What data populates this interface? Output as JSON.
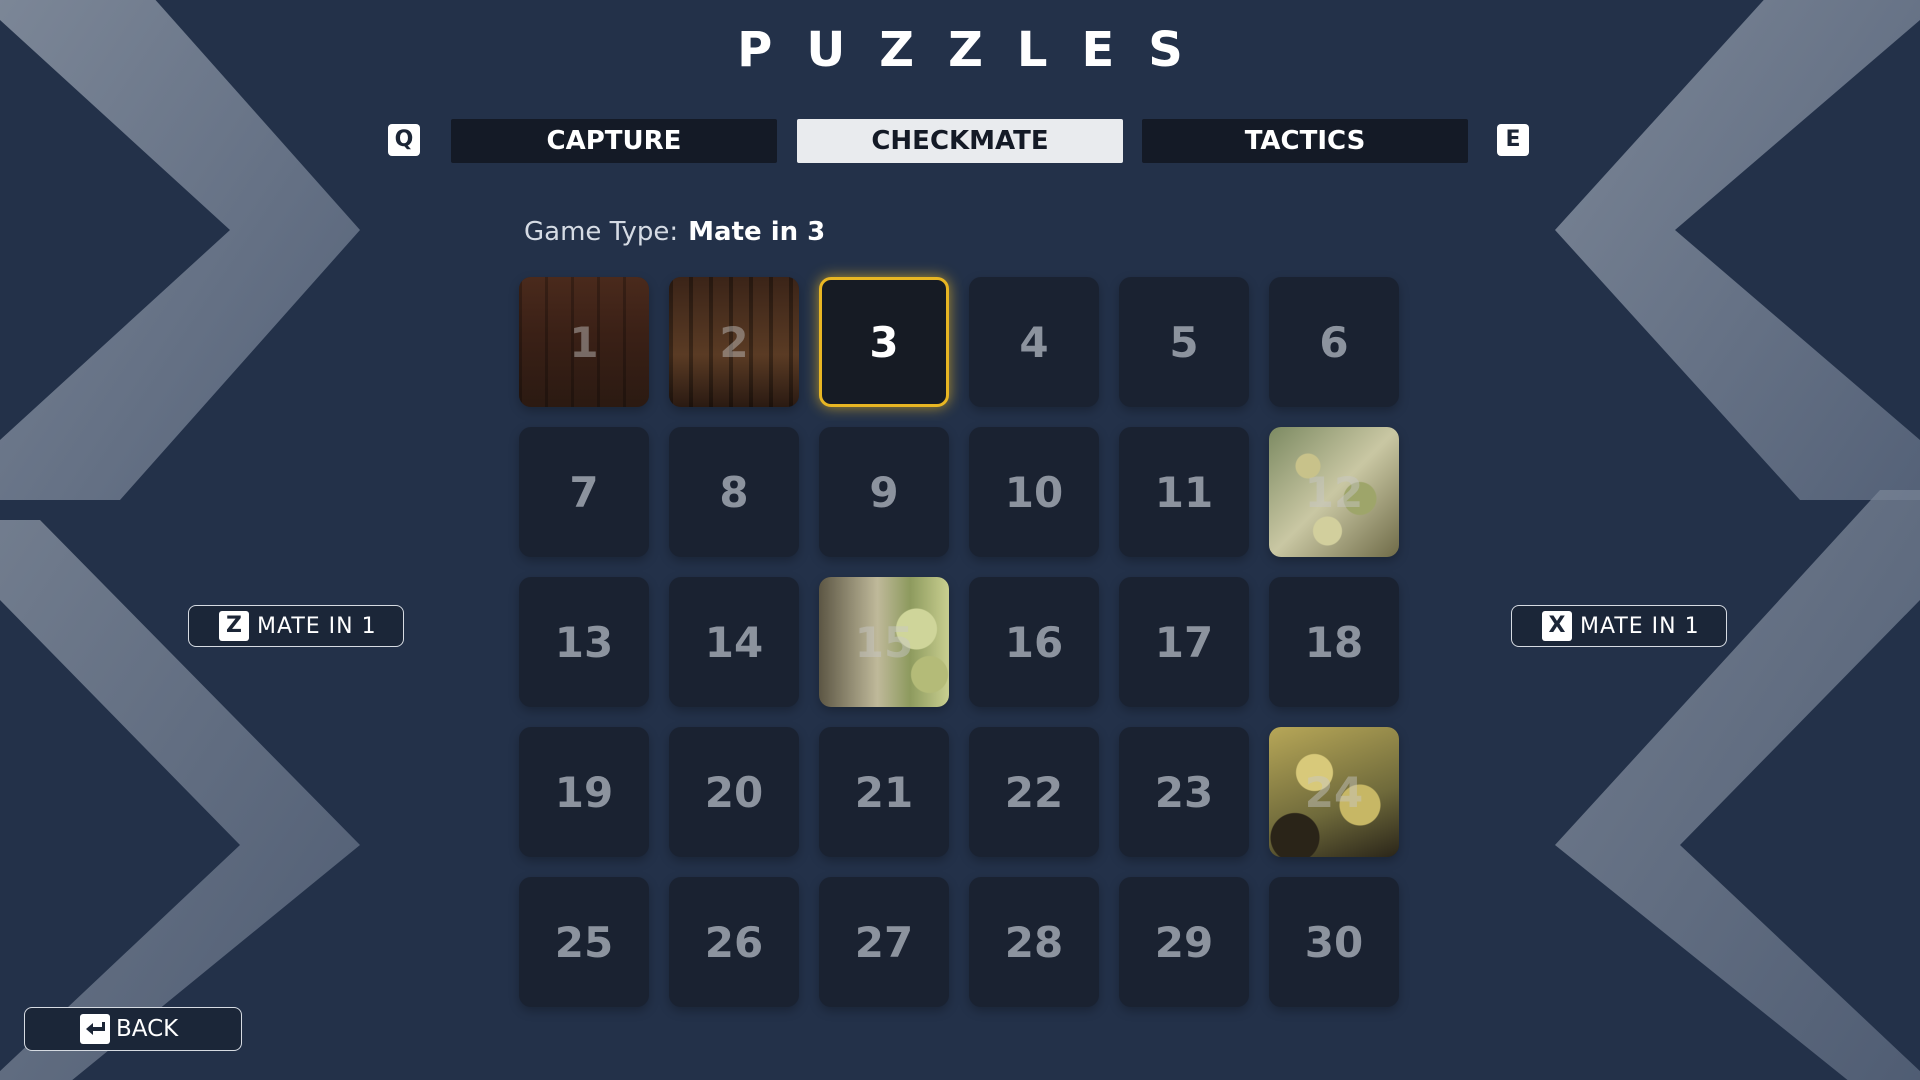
{
  "title": "PUZZLES",
  "tabs": {
    "prev_key": "Q",
    "next_key": "E",
    "items": [
      {
        "label": "CAPTURE",
        "active": false
      },
      {
        "label": "CHECKMATE",
        "active": true
      },
      {
        "label": "TACTICS",
        "active": false
      }
    ]
  },
  "game_type": {
    "label": "Game Type:",
    "value": "Mate in 3"
  },
  "puzzles": [
    "1",
    "2",
    "3",
    "4",
    "5",
    "6",
    "7",
    "8",
    "9",
    "10",
    "11",
    "12",
    "13",
    "14",
    "15",
    "16",
    "17",
    "18",
    "19",
    "20",
    "21",
    "22",
    "23",
    "24",
    "25",
    "26",
    "27",
    "28",
    "29",
    "30"
  ],
  "selected_puzzle": "3",
  "prev_mode": {
    "key": "Z",
    "label": "MATE IN 1"
  },
  "next_mode": {
    "key": "X",
    "label": "MATE IN 1"
  },
  "back": {
    "label": "BACK",
    "icon": "back-arrow-icon"
  },
  "colors": {
    "background": "#233149",
    "selected_border": "#e8b623",
    "tile": "#1a2231",
    "active_tab": "#e9ebee"
  }
}
